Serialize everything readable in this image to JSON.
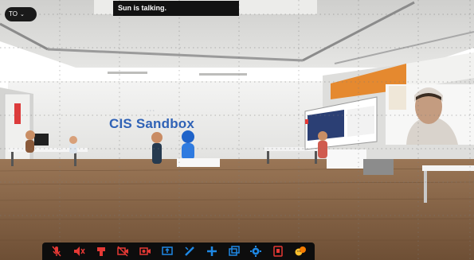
{
  "top_pill": {
    "label": "TO",
    "chevron": "chevron-down-icon"
  },
  "speaker_banner": {
    "text": "Sun is talking."
  },
  "room_sign": {
    "title": "CIS Sandbox"
  },
  "toolbar": {
    "buttons": [
      {
        "icon": "microphone-muted-icon",
        "color": "#e53935"
      },
      {
        "icon": "speaker-muted-icon",
        "color": "#e53935"
      },
      {
        "icon": "hand-raise-icon",
        "color": "#e53935"
      },
      {
        "icon": "camera-off-icon",
        "color": "#e53935"
      },
      {
        "icon": "video-record-icon",
        "color": "#e53935"
      },
      {
        "icon": "screen-share-icon",
        "color": "#1e88e5"
      },
      {
        "icon": "pen-icon",
        "color": "#1e88e5"
      },
      {
        "icon": "plus-icon",
        "color": "#1e88e5"
      },
      {
        "icon": "windows-icon",
        "color": "#1e88e5"
      },
      {
        "icon": "settings-icon",
        "color": "#1e88e5"
      },
      {
        "icon": "leave-icon",
        "color": "#e53935"
      },
      {
        "icon": "emoji-icon",
        "color": "#fbc02d"
      }
    ]
  }
}
